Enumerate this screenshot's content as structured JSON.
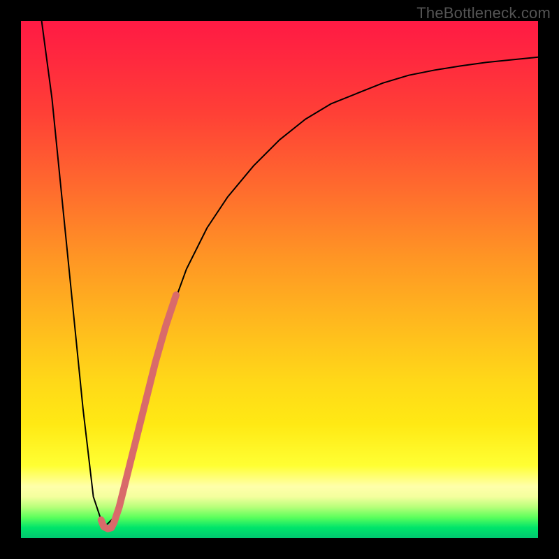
{
  "watermark": "TheBottleneck.com",
  "chart_data": {
    "type": "line",
    "title": "",
    "xlabel": "",
    "ylabel": "",
    "xlim": [
      0,
      100
    ],
    "ylim": [
      0,
      100
    ],
    "grid": false,
    "series": [
      {
        "name": "bottleneck-curve",
        "color": "#000000",
        "width": 2,
        "x": [
          4,
          6,
          8,
          10,
          12,
          14,
          16,
          18,
          20,
          24,
          28,
          32,
          36,
          40,
          45,
          50,
          55,
          60,
          65,
          70,
          75,
          80,
          85,
          90,
          95,
          100
        ],
        "y": [
          100,
          85,
          65,
          45,
          25,
          8,
          2,
          4,
          10,
          26,
          41,
          52,
          60,
          66,
          72,
          77,
          81,
          84,
          86,
          88,
          89.5,
          90.5,
          91.3,
          92,
          92.5,
          93
        ]
      },
      {
        "name": "marker-segment",
        "color": "#d96a6a",
        "width": 10,
        "x": [
          17.5,
          18,
          19,
          20,
          21,
          22,
          24,
          26,
          28,
          30
        ],
        "y": [
          2,
          3,
          6,
          10,
          14,
          18,
          26,
          34,
          41,
          47
        ]
      },
      {
        "name": "marker-hook",
        "color": "#d96a6a",
        "width": 10,
        "x": [
          15.5,
          16,
          16.8,
          17.5
        ],
        "y": [
          3.5,
          2.2,
          1.8,
          2
        ]
      }
    ]
  }
}
